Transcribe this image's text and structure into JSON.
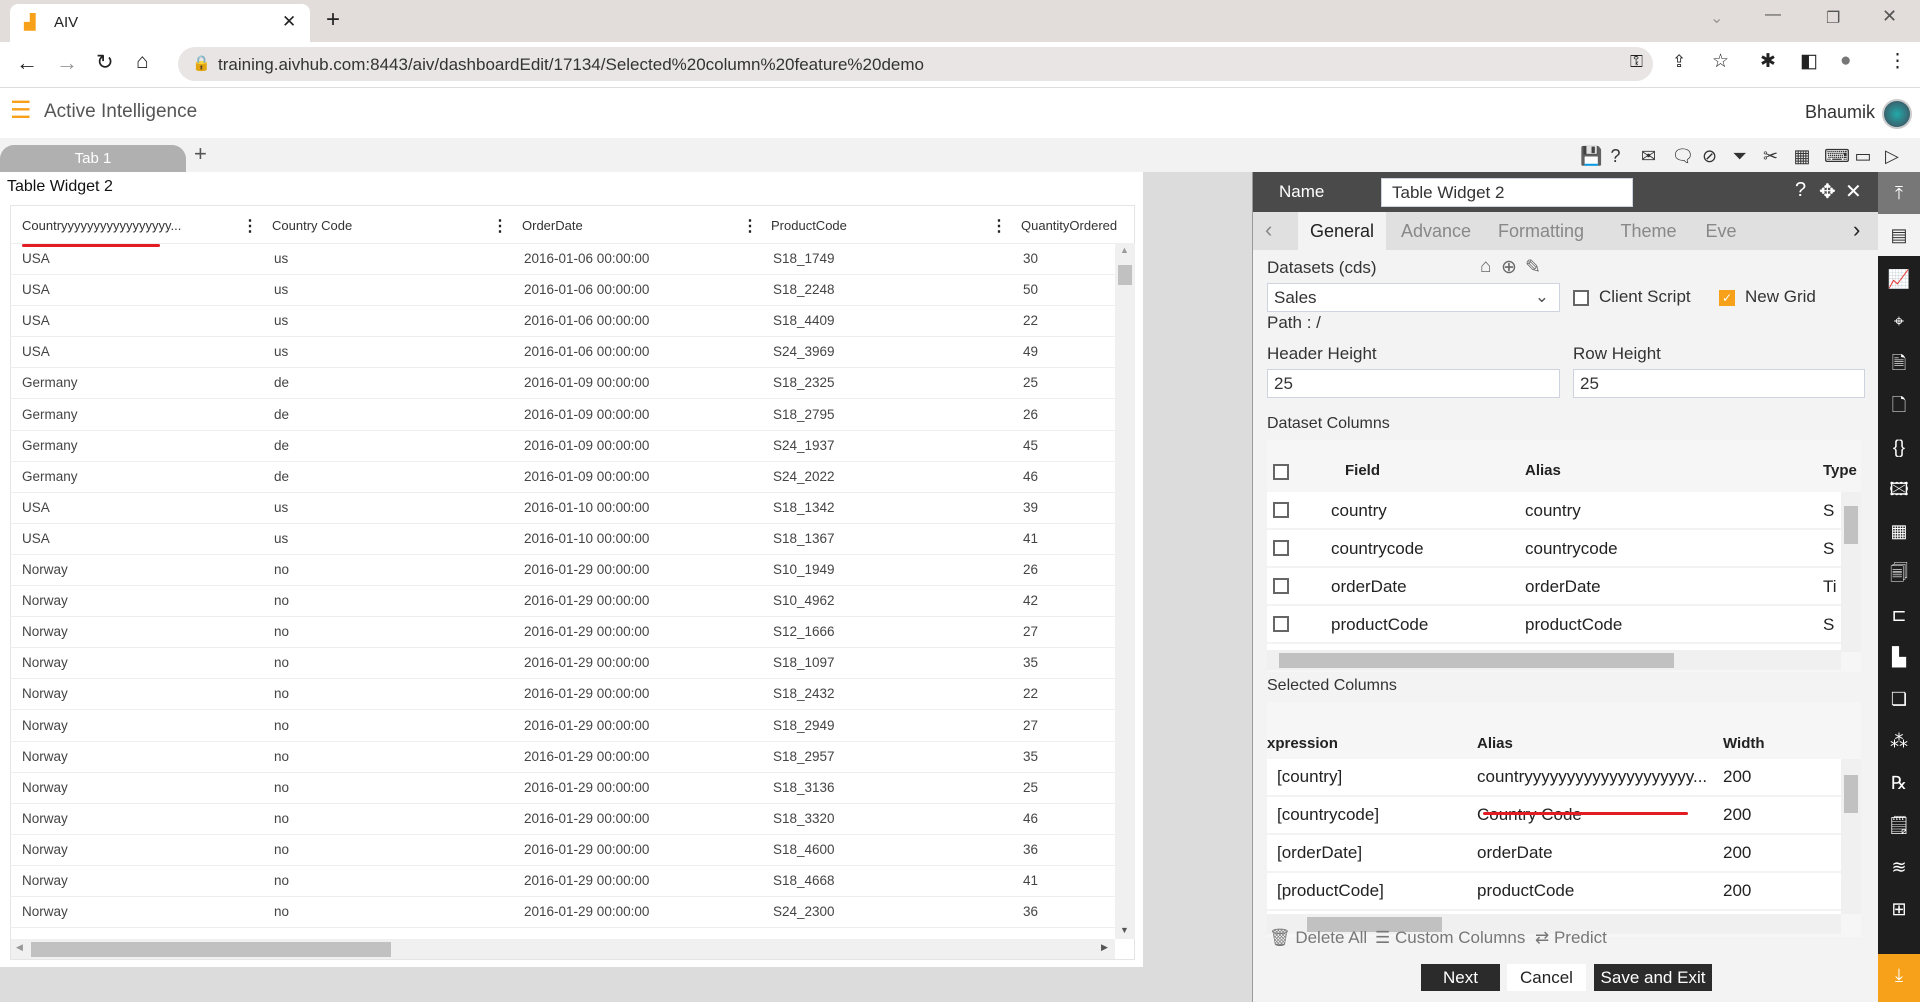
{
  "browser": {
    "tab_title": "AIV",
    "url": "training.aivhub.com:8443/aiv/dashboardEdit/17134/Selected%20column%20feature%20demo"
  },
  "app": {
    "title": "Active Intelligence",
    "user": "Bhaumik",
    "tab": "Tab 1"
  },
  "toolbar_icons": [
    "save-icon",
    "help-icon",
    "mail-icon",
    "comment-icon",
    "clear-filter-icon",
    "filter-icon",
    "tools-icon",
    "table-icon",
    "embed-icon",
    "devices-icon",
    "play-icon"
  ],
  "widget": {
    "title": "Table Widget 2",
    "columns": [
      "Countryyyyyyyyyyyyyyyyy...",
      "Country Code",
      "OrderDate",
      "ProductCode",
      "QuantityOrdered"
    ],
    "rows": [
      [
        "USA",
        "us",
        "2016-01-06 00:00:00",
        "S18_1749",
        "30"
      ],
      [
        "USA",
        "us",
        "2016-01-06 00:00:00",
        "S18_2248",
        "50"
      ],
      [
        "USA",
        "us",
        "2016-01-06 00:00:00",
        "S18_4409",
        "22"
      ],
      [
        "USA",
        "us",
        "2016-01-06 00:00:00",
        "S24_3969",
        "49"
      ],
      [
        "Germany",
        "de",
        "2016-01-09 00:00:00",
        "S18_2325",
        "25"
      ],
      [
        "Germany",
        "de",
        "2016-01-09 00:00:00",
        "S18_2795",
        "26"
      ],
      [
        "Germany",
        "de",
        "2016-01-09 00:00:00",
        "S24_1937",
        "45"
      ],
      [
        "Germany",
        "de",
        "2016-01-09 00:00:00",
        "S24_2022",
        "46"
      ],
      [
        "USA",
        "us",
        "2016-01-10 00:00:00",
        "S18_1342",
        "39"
      ],
      [
        "USA",
        "us",
        "2016-01-10 00:00:00",
        "S18_1367",
        "41"
      ],
      [
        "Norway",
        "no",
        "2016-01-29 00:00:00",
        "S10_1949",
        "26"
      ],
      [
        "Norway",
        "no",
        "2016-01-29 00:00:00",
        "S10_4962",
        "42"
      ],
      [
        "Norway",
        "no",
        "2016-01-29 00:00:00",
        "S12_1666",
        "27"
      ],
      [
        "Norway",
        "no",
        "2016-01-29 00:00:00",
        "S18_1097",
        "35"
      ],
      [
        "Norway",
        "no",
        "2016-01-29 00:00:00",
        "S18_2432",
        "22"
      ],
      [
        "Norway",
        "no",
        "2016-01-29 00:00:00",
        "S18_2949",
        "27"
      ],
      [
        "Norway",
        "no",
        "2016-01-29 00:00:00",
        "S18_2957",
        "35"
      ],
      [
        "Norway",
        "no",
        "2016-01-29 00:00:00",
        "S18_3136",
        "25"
      ],
      [
        "Norway",
        "no",
        "2016-01-29 00:00:00",
        "S18_3320",
        "46"
      ],
      [
        "Norway",
        "no",
        "2016-01-29 00:00:00",
        "S18_4600",
        "36"
      ],
      [
        "Norway",
        "no",
        "2016-01-29 00:00:00",
        "S18_4668",
        "41"
      ],
      [
        "Norway",
        "no",
        "2016-01-29 00:00:00",
        "S24_2300",
        "36"
      ]
    ]
  },
  "panel": {
    "name_label": "Name",
    "name_value": "Table Widget 2",
    "tabs": [
      "General",
      "Advance",
      "Formatting",
      "Theme",
      "Eve"
    ],
    "datasets_label": "Datasets (cds)",
    "dataset_value": "Sales",
    "client_script": "Client Script",
    "new_grid": "New Grid",
    "path": "Path : /",
    "header_height_label": "Header Height",
    "header_height": "25",
    "row_height_label": "Row Height",
    "row_height": "25",
    "dataset_columns_label": "Dataset Columns",
    "dc_headers": [
      "Field",
      "Alias",
      "Type"
    ],
    "dc_rows": [
      [
        "country",
        "country",
        "S"
      ],
      [
        "countrycode",
        "countrycode",
        "S"
      ],
      [
        "orderDate",
        "orderDate",
        "Ti"
      ],
      [
        "productCode",
        "productCode",
        "S"
      ]
    ],
    "selected_columns_label": "Selected Columns",
    "sc_headers": [
      "xpression",
      "Alias",
      "Width"
    ],
    "sc_rows": [
      [
        "[country]",
        "countryyyyyyyyyyyyyyyyyyyy...",
        "200"
      ],
      [
        "[countrycode]",
        "Country Code",
        "200"
      ],
      [
        "[orderDate]",
        "orderDate",
        "200"
      ],
      [
        "[productCode]",
        "productCode",
        "200"
      ]
    ],
    "delete_all": "Delete All",
    "custom_columns": "Custom Columns",
    "predict": "Predict",
    "next": "Next",
    "cancel": "Cancel",
    "save_exit": "Save and Exit"
  },
  "colors": {
    "accent": "#f7a11a",
    "annotation": "#e31b23",
    "header_dark": "#4a4a4a"
  }
}
